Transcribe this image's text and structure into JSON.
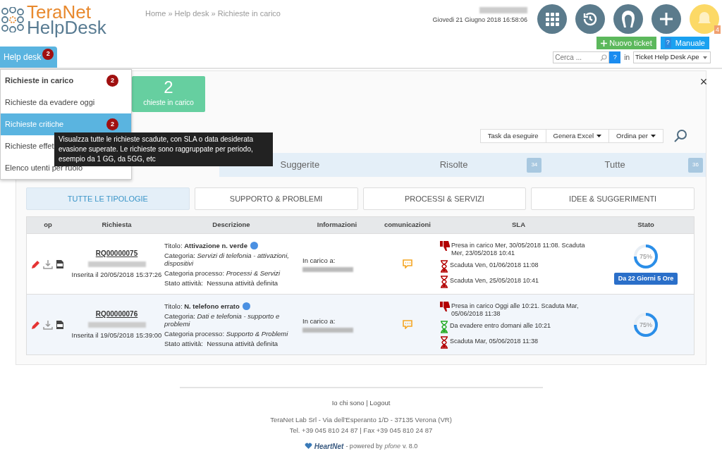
{
  "logo": {
    "line_1": "TeraNet",
    "line_2": "HelpDesk"
  },
  "breadcrumb": "Home » Help desk » Richieste in carico",
  "datetime": "Giovedi 21 Giugno 2018 16:58:06",
  "notifications": {
    "count": "4"
  },
  "buttons": {
    "new_ticket": "Nuovo ticket",
    "manual_icon": "?",
    "manual": "Manuale"
  },
  "nav": {
    "tab": "Help desk",
    "badge": "2"
  },
  "search": {
    "placeholder": "Cerca ...",
    "help": "?",
    "in_label": "in",
    "scope": "Ticket Help Desk Ape"
  },
  "menu": [
    {
      "label": "Richieste in carico",
      "badge": "2",
      "selected": false,
      "bold": true
    },
    {
      "label": "Richieste da evadere oggi",
      "selected": false,
      "bold": false
    },
    {
      "label": "Richieste critiche",
      "badge": "2",
      "selected": true,
      "bold": false
    },
    {
      "label": "Richieste effet",
      "selected": false,
      "bold": false
    },
    {
      "label": "Elenco utenti per ruolo",
      "selected": false,
      "bold": false
    }
  ],
  "tooltip": "Visualzza tutte le richieste scadute, con SLA o data desiderata evasione superate. Le richieste sono raggruppate per periodo, esempio da 1 GG, da 5GG, etc",
  "close": "×",
  "summary_card": {
    "count": "2",
    "label": "chieste in carico"
  },
  "toolbar": [
    {
      "label": "Task da eseguire",
      "dropdown": false
    },
    {
      "label": "Genera Excel",
      "dropdown": true
    },
    {
      "label": "Ordina per",
      "dropdown": true
    }
  ],
  "status_tabs": [
    {
      "label": "Suggerite"
    },
    {
      "label": "Risolte",
      "count": "34"
    },
    {
      "label": "Tutte",
      "count": "36"
    }
  ],
  "filters": [
    {
      "label": "TUTTE LE TIPOLOGIE",
      "selected": true
    },
    {
      "label": "SUPPORTO & PROBLEMI",
      "selected": false
    },
    {
      "label": "PROCESSI & SERVIZI",
      "selected": false
    },
    {
      "label": "IDEE & SUGGERIMENTI",
      "selected": false
    }
  ],
  "table": {
    "columns": [
      "op",
      "Richiesta",
      "Descrizione",
      "Informazioni",
      "comunicazioni",
      "SLA",
      "Stato"
    ],
    "rows": [
      {
        "id": "RQ00000075",
        "inserted": "Inserita il 20/05/2018 15:37:26",
        "title_label": "Titolo:",
        "title": "Attivazione n. verde",
        "category_label": "Categoria:",
        "category": "Servizi di telefonia - attivazioni, dispositivi",
        "process_label": "Categoria processo:",
        "process": "Processi & Servizi",
        "state_label": "Stato attività:",
        "state": "Nessuna attività definita",
        "assigned": "In carico a:",
        "sla": [
          {
            "kind": "thumb",
            "color": "#b30000",
            "text": "Presa in carico Mer, 30/05/2018 11:08. Scaduta Mer, 23/05/2018 10:41"
          },
          {
            "kind": "hourglass",
            "color": "#b30000",
            "text": "Scaduta Ven, 01/06/2018 11:08"
          },
          {
            "kind": "hourglass",
            "color": "#b30000",
            "text": "Scaduta Ven, 25/05/2018 10:41"
          }
        ],
        "level": 0.75,
        "percent": "75%",
        "badge": "Da 22 Giorni 5 Ore"
      },
      {
        "id": "RQ00000076",
        "inserted": "Inserita il 19/05/2018 15:39:00",
        "title_label": "Titolo:",
        "title": "N. telefono errato",
        "category_label": "Categoria:",
        "category": "Dati e telefonia - supporto e problemi",
        "process_label": "Categoria processo:",
        "process": "Supporto & Problemi",
        "state_label": "Stato attività:",
        "state": "Nessuna attività definita",
        "assigned": "In carico a:",
        "sla": [
          {
            "kind": "thumb",
            "color": "#b30000",
            "text": "Presa in carico Oggi alle 10:21. Scaduta Mar, 05/06/2018 11:38"
          },
          {
            "kind": "hourglass",
            "color": "#22aa22",
            "text": "Da evadere entro domani alle 10:21"
          },
          {
            "kind": "hourglass",
            "color": "#b30000",
            "text": "Scaduta Mar, 05/06/2018 11:38"
          }
        ],
        "level": 0.75,
        "percent": "75%"
      }
    ]
  },
  "footer": {
    "links": "Io chi sono | Logout",
    "address": "TeraNet Lab Srl - Via dell'Esperanto 1/D - 37135 Verona (VR)",
    "phone": "Tel. +39 045 810 24 87 | Fax +39 045 810 24 87",
    "brand": "HeartNet",
    "powered": "- powered by",
    "brand_2": "pfone",
    "version": "v. 8.0"
  }
}
